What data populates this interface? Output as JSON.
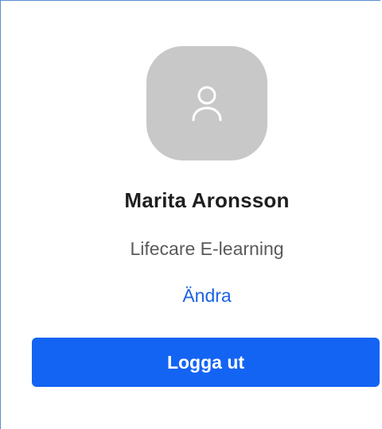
{
  "profile": {
    "name": "Marita Aronsson",
    "organization": "Lifecare E-learning",
    "change_label": "Ändra",
    "avatar_icon": "user-icon"
  },
  "actions": {
    "logout_label": "Logga ut"
  },
  "colors": {
    "accent": "#1464f4",
    "link": "#1a63e3",
    "avatar_bg": "#c8c8c8",
    "frame_border": "#5b8fd0"
  }
}
